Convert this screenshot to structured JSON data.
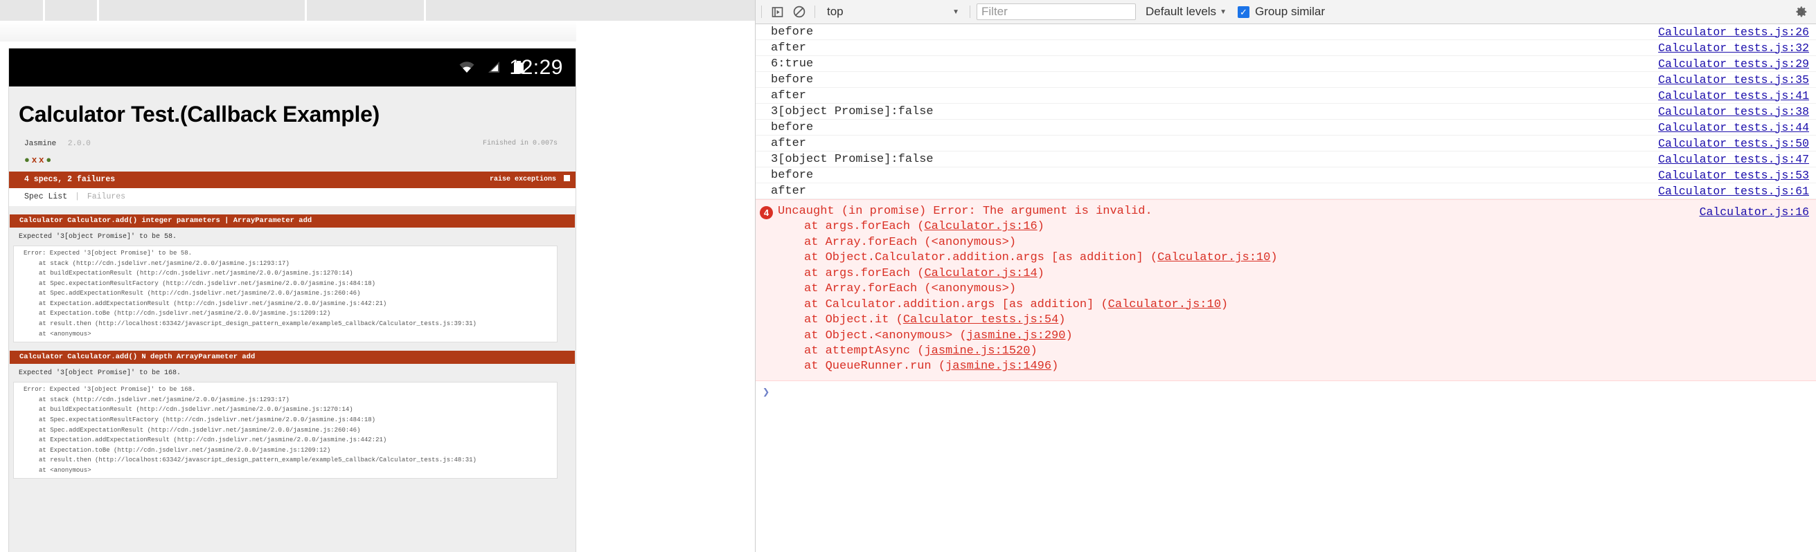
{
  "left_pane": {
    "status_bar": {
      "clock": "12:29",
      "icons": [
        "wifi-icon",
        "signal-icon",
        "battery-icon"
      ]
    },
    "jasmine": {
      "title": "Calculator Test.(Callback Example)",
      "framework": "Jasmine",
      "version": "2.0.0",
      "finished": "Finished in 0.007s",
      "symbols": [
        "pass",
        "fail",
        "fail",
        "pass"
      ],
      "alert_bar": "4 specs, 2 failures",
      "raise_exceptions_label": "raise exceptions",
      "menu": {
        "spec_list": "Spec List",
        "separator": "|",
        "failures": "Failures"
      },
      "failures": [
        {
          "title": "Calculator Calculator.add() integer parameters | ArrayParameter add",
          "message": "Expected '3[object Promise]' to be 58.",
          "stack": [
            "Error: Expected '3[object Promise]' to be 58.",
            "at stack (http://cdn.jsdelivr.net/jasmine/2.0.0/jasmine.js:1293:17)",
            "at buildExpectationResult (http://cdn.jsdelivr.net/jasmine/2.0.0/jasmine.js:1270:14)",
            "at Spec.expectationResultFactory (http://cdn.jsdelivr.net/jasmine/2.0.0/jasmine.js:484:18)",
            "at Spec.addExpectationResult (http://cdn.jsdelivr.net/jasmine/2.0.0/jasmine.js:260:46)",
            "at Expectation.addExpectationResult (http://cdn.jsdelivr.net/jasmine/2.0.0/jasmine.js:442:21)",
            "at Expectation.toBe (http://cdn.jsdelivr.net/jasmine/2.0.0/jasmine.js:1209:12)",
            "at result.then (http://localhost:63342/javascript_design_pattern_example/example5_callback/Calculator_tests.js:39:31)",
            "at <anonymous>"
          ]
        },
        {
          "title": "Calculator Calculator.add() N depth ArrayParameter add",
          "message": "Expected '3[object Promise]' to be 168.",
          "stack": [
            "Error: Expected '3[object Promise]' to be 168.",
            "at stack (http://cdn.jsdelivr.net/jasmine/2.0.0/jasmine.js:1293:17)",
            "at buildExpectationResult (http://cdn.jsdelivr.net/jasmine/2.0.0/jasmine.js:1270:14)",
            "at Spec.expectationResultFactory (http://cdn.jsdelivr.net/jasmine/2.0.0/jasmine.js:484:18)",
            "at Spec.addExpectationResult (http://cdn.jsdelivr.net/jasmine/2.0.0/jasmine.js:260:46)",
            "at Expectation.addExpectationResult (http://cdn.jsdelivr.net/jasmine/2.0.0/jasmine.js:442:21)",
            "at Expectation.toBe (http://cdn.jsdelivr.net/jasmine/2.0.0/jasmine.js:1209:12)",
            "at result.then (http://localhost:63342/javascript_design_pattern_example/example5_callback/Calculator_tests.js:48:31)",
            "at <anonymous>"
          ]
        }
      ]
    }
  },
  "devtools": {
    "toolbar": {
      "sidebar_toggle_icon": "show-console-sidebar-icon",
      "clear_console_icon": "clear-console-icon",
      "context_selected": "top",
      "context_caret": "▼",
      "filter_placeholder": "Filter",
      "filter_value": "",
      "levels_label": "Default levels",
      "levels_caret": "▼",
      "group_similar_label": "Group similar",
      "group_similar_checked": true,
      "group_similar_check_glyph": "✓",
      "settings_icon": "gear-icon",
      "accent_color": "#1a73e8"
    },
    "log_entries": [
      {
        "message": "before",
        "source": "Calculator_tests.js:26"
      },
      {
        "message": "after",
        "source": "Calculator_tests.js:32"
      },
      {
        "message": "6:true",
        "source": "Calculator_tests.js:29"
      },
      {
        "message": "before",
        "source": "Calculator_tests.js:35"
      },
      {
        "message": "after",
        "source": "Calculator_tests.js:41"
      },
      {
        "message": "3[object Promise]:false",
        "source": "Calculator_tests.js:38"
      },
      {
        "message": "before",
        "source": "Calculator_tests.js:44"
      },
      {
        "message": "after",
        "source": "Calculator_tests.js:50"
      },
      {
        "message": "3[object Promise]:false",
        "source": "Calculator_tests.js:47"
      },
      {
        "message": "before",
        "source": "Calculator_tests.js:53"
      },
      {
        "message": "after",
        "source": "Calculator_tests.js:61"
      }
    ],
    "error_group": {
      "count": "4",
      "headline": "Uncaught (in promise) Error: The argument is invalid.",
      "source": "Calculator.js:16",
      "error_color": "#d93025",
      "stack": [
        {
          "prefix": "at args.forEach (",
          "link": "Calculator.js:16",
          "suffix": ")"
        },
        {
          "prefix": "at Array.forEach (<anonymous>)",
          "link": "",
          "suffix": ""
        },
        {
          "prefix": "at Object.Calculator.addition.args [as addition] (",
          "link": "Calculator.js:10",
          "suffix": ")"
        },
        {
          "prefix": "at args.forEach (",
          "link": "Calculator.js:14",
          "suffix": ")"
        },
        {
          "prefix": "at Array.forEach (<anonymous>)",
          "link": "",
          "suffix": ""
        },
        {
          "prefix": "at Calculator.addition.args [as addition] (",
          "link": "Calculator.js:10",
          "suffix": ")"
        },
        {
          "prefix": "at Object.it (",
          "link": "Calculator_tests.js:54",
          "suffix": ")"
        },
        {
          "prefix": "at Object.<anonymous> (",
          "link": "jasmine.js:290",
          "suffix": ")"
        },
        {
          "prefix": "at attemptAsync (",
          "link": "jasmine.js:1520",
          "suffix": ")"
        },
        {
          "prefix": "at QueueRunner.run (",
          "link": "jasmine.js:1496",
          "suffix": ")"
        }
      ]
    },
    "prompt_caret": "❯"
  }
}
